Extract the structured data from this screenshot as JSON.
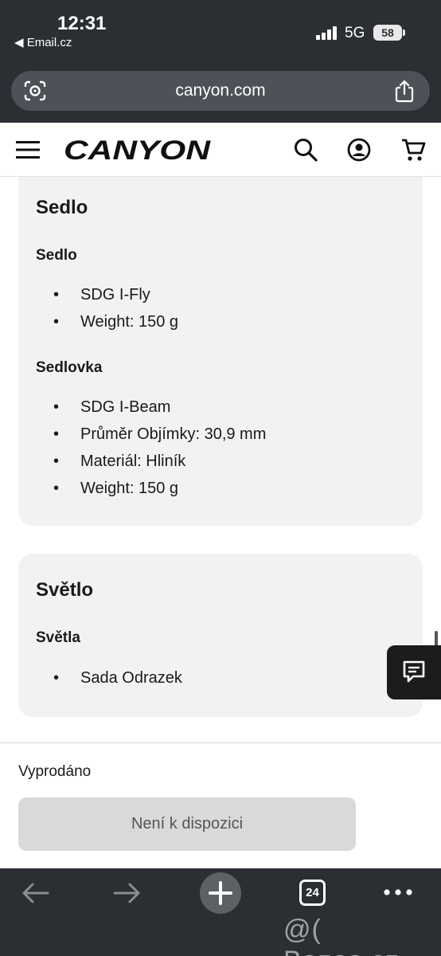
{
  "status_bar": {
    "time": "12:31",
    "back_label": "◀ Email.cz",
    "network": "5G",
    "battery": "58"
  },
  "browser": {
    "url": "canyon.com",
    "tab_count": "24",
    "watermark": "@( Bazos.cz"
  },
  "header": {
    "logo": "CANYON",
    "icons": [
      "menu-icon",
      "search-icon",
      "account-icon",
      "cart-icon"
    ]
  },
  "sections": [
    {
      "title": "Sedlo",
      "groups": [
        {
          "title": "Sedlo",
          "items": [
            "SDG I-Fly",
            "Weight: 150 g"
          ]
        },
        {
          "title": "Sedlovka",
          "items": [
            "SDG I-Beam",
            "Průměr Objímky: 30,9 mm",
            "Materiál: Hliník",
            "Weight: 150 g"
          ]
        }
      ]
    },
    {
      "title": "Světlo",
      "groups": [
        {
          "title": "Světla",
          "items": [
            "Sada Odrazek"
          ]
        }
      ]
    }
  ],
  "bullet_char": "•",
  "purchase": {
    "status": "Vyprodáno",
    "button_label": "Není k dispozici"
  },
  "colors": {
    "chrome": "#2b2f33",
    "card_bg": "#f2f2f2",
    "disabled_button": "#d9d9d9"
  }
}
